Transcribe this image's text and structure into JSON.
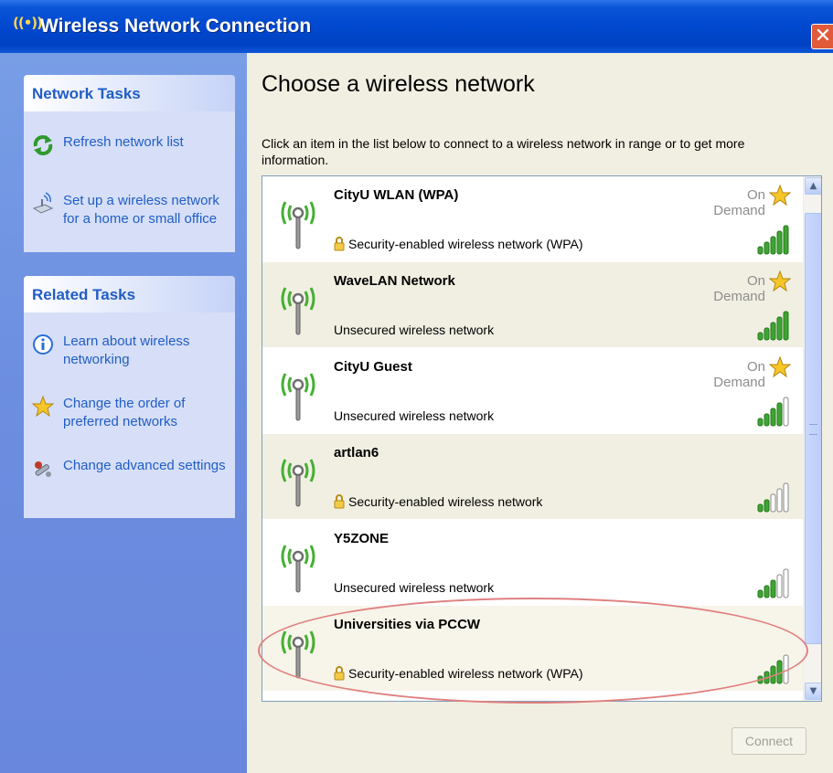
{
  "window": {
    "title": "Wireless Network Connection",
    "close_glyph": "✕"
  },
  "sidebar": {
    "network_tasks": {
      "heading": "Network Tasks",
      "items": [
        {
          "label": "Refresh network list",
          "icon": "refresh-icon"
        },
        {
          "label": "Set up a wireless network for a home or small office",
          "icon": "setup-wizard-icon"
        }
      ]
    },
    "related_tasks": {
      "heading": "Related Tasks",
      "items": [
        {
          "label": "Learn about wireless networking",
          "icon": "info-icon"
        },
        {
          "label": "Change the order of preferred networks",
          "icon": "star-icon"
        },
        {
          "label": "Change advanced settings",
          "icon": "settings-icon"
        }
      ]
    }
  },
  "main": {
    "heading": "Choose a wireless network",
    "description": "Click an item in the list below to connect to a wireless network in range or to get more information.",
    "networks": [
      {
        "name": "CityU WLAN (WPA)",
        "status": "On Demand",
        "security": "Security-enabled wireless network (WPA)",
        "secured": true,
        "preferred": true,
        "signal_bars": 5
      },
      {
        "name": "WaveLAN Network",
        "status": "On Demand",
        "security": "Unsecured wireless network",
        "secured": false,
        "preferred": true,
        "signal_bars": 5
      },
      {
        "name": "CityU Guest",
        "status": "On Demand",
        "security": "Unsecured wireless network",
        "secured": false,
        "preferred": true,
        "signal_bars": 4
      },
      {
        "name": "artlan6",
        "status": "",
        "security": "Security-enabled wireless network",
        "secured": true,
        "preferred": false,
        "signal_bars": 2
      },
      {
        "name": "Y5ZONE",
        "status": "",
        "security": "Unsecured wireless network",
        "secured": false,
        "preferred": false,
        "signal_bars": 3
      },
      {
        "name": "Universities via PCCW",
        "status": "",
        "security": "Security-enabled wireless network (WPA)",
        "secured": true,
        "preferred": false,
        "signal_bars": 4
      }
    ],
    "connect_label": "Connect"
  },
  "colors": {
    "titlebar": "#0048cf",
    "sidebar": "#6c8de0",
    "link": "#215dc6",
    "highlight_ring": "#e08080",
    "signal_on": "#3ea532"
  }
}
